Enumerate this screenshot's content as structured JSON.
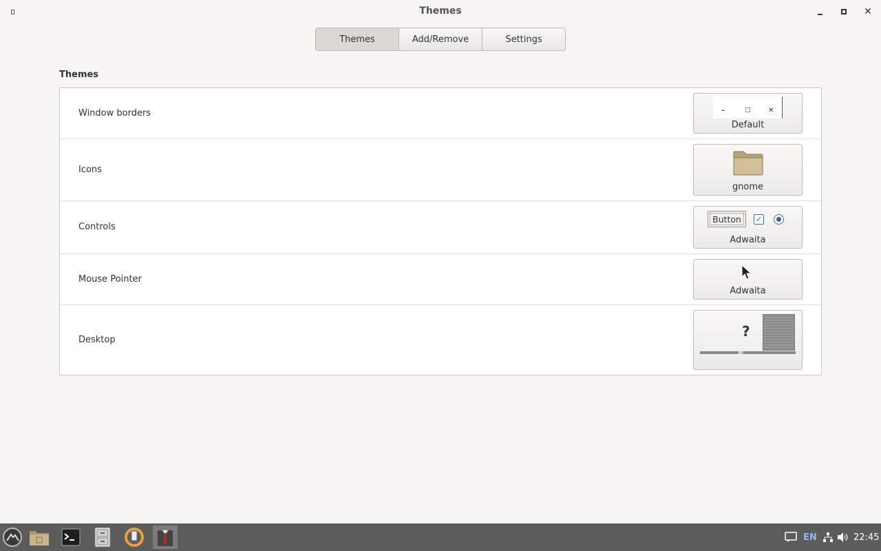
{
  "window": {
    "title": "Themes"
  },
  "tabs": [
    {
      "label": "Themes",
      "active": true
    },
    {
      "label": "Add/Remove",
      "active": false
    },
    {
      "label": "Settings",
      "active": false
    }
  ],
  "section": {
    "title": "Themes"
  },
  "rows": [
    {
      "label": "Window borders",
      "value": "Default",
      "preview": "window-buttons"
    },
    {
      "label": "Icons",
      "value": "gnome",
      "preview": "folder-icon"
    },
    {
      "label": "Controls",
      "value": "Adwaita",
      "preview": "controls",
      "preview_button_label": "Button"
    },
    {
      "label": "Mouse Pointer",
      "value": "Adwaita",
      "preview": "pointer"
    },
    {
      "label": "Desktop",
      "value": "",
      "preview": "desktop",
      "preview_glyph": "?"
    }
  ],
  "taskbar": {
    "apps": [
      {
        "icon": "start-menu-icon"
      },
      {
        "icon": "file-manager-icon"
      },
      {
        "icon": "terminal-icon"
      },
      {
        "icon": "filing-cabinet-icon"
      },
      {
        "icon": "update-manager-icon"
      },
      {
        "icon": "tweak-tool-icon",
        "active": true
      }
    ],
    "tray": {
      "language": "EN",
      "clock": "22:45"
    }
  },
  "colors": {
    "accent": "#3465a4",
    "taskbar": "#5c5c5c",
    "folder": "#c9b58c"
  }
}
